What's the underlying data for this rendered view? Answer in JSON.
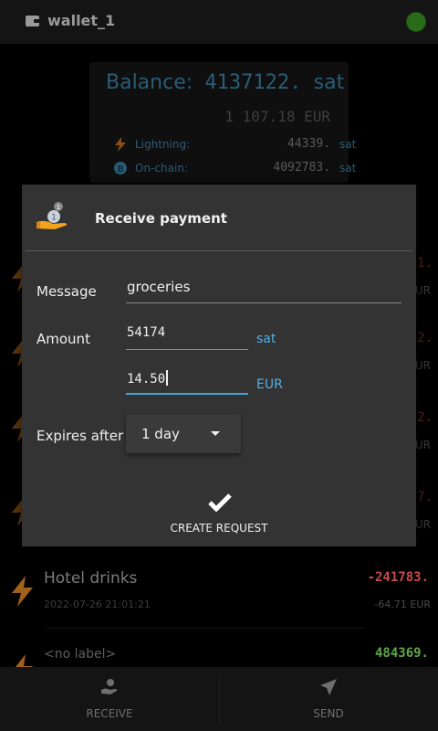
{
  "topbar": {
    "wallet_name": "wallet_1"
  },
  "balance": {
    "label": "Balance:",
    "value": "4137122.",
    "unit": "sat",
    "fiat": "1 107.18 EUR",
    "lightning": {
      "label": "Lightning:",
      "value": "44339.",
      "unit": "sat"
    },
    "onchain": {
      "label": "On-chain:",
      "value": "4092783.",
      "unit": "sat"
    }
  },
  "background_rows": [
    {
      "amount_edge": "1.",
      "fiat_edge": "UR"
    },
    {
      "amount_edge": "2.",
      "fiat_edge": "UR"
    },
    {
      "amount_edge": "2.",
      "fiat_edge": "UR"
    },
    {
      "amount_edge": "7.",
      "fiat_edge": "UR"
    }
  ],
  "transactions": [
    {
      "label": "Hotel drinks",
      "date": "2022-07-26 21:01:21",
      "amount": "-241783.",
      "fiat": "-64.71 EUR",
      "amount_color": "#c94a4a"
    },
    {
      "label": "<no label>",
      "amount": "484369.",
      "amount_color": "#5ea84a"
    }
  ],
  "dialog": {
    "title": "Receive payment",
    "message_label": "Message",
    "message_value": "groceries",
    "amount_label": "Amount",
    "amount_sat": "54174",
    "sat_unit": "sat",
    "amount_fiat": "14.50",
    "fiat_unit": "EUR",
    "expires_label": "Expires after",
    "expires_value": "1 day",
    "create_label": "CREATE REQUEST"
  },
  "bottombar": {
    "receive_label": "RECEIVE",
    "send_label": "SEND"
  }
}
